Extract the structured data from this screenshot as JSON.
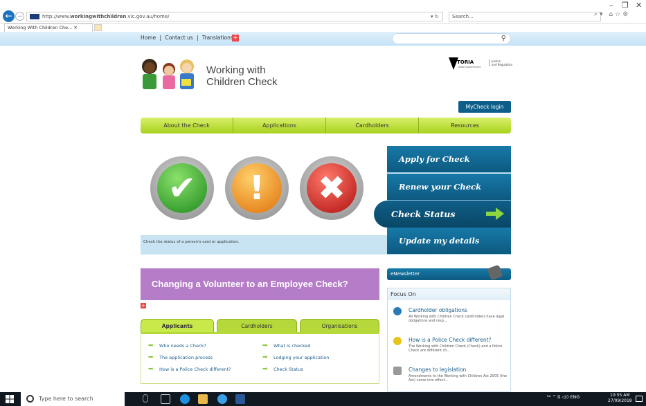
{
  "browser": {
    "url_prefix": "http://www.",
    "url_bold": "workingwithchildren",
    "url_suffix": ".vic.gov.au/home/",
    "refresh_label": "▾ ↻",
    "search_placeholder": "Search...",
    "tab_title": "Working With Children Che... ✕"
  },
  "topnav": {
    "home": "Home",
    "contact": "Contact us",
    "translations": "Translations",
    "sep": "|",
    "plus": "+"
  },
  "logo": {
    "line1": "Working with",
    "line2": "Children Check"
  },
  "victoria": {
    "name": "TORIA",
    "gov": "State Government",
    "dept1": "Justice",
    "dept2": "and Regulation"
  },
  "mycheck_label": "MyCheck login",
  "mainnav": [
    "About the Check",
    "Applications",
    "Cardholders",
    "Resources"
  ],
  "hero": {
    "caption": "Check the status of a person's card or application.",
    "glyph_ok": "✔",
    "glyph_warn": "!",
    "glyph_err": "✖"
  },
  "side_menu": {
    "apply": "Apply for Check",
    "renew": "Renew your Check",
    "status": "Check Status",
    "update": "Update my details"
  },
  "banner": "Changing a Volunteer to an Employee Check?",
  "banner_plus": "+",
  "tabs": [
    "Applicants",
    "Cardholders",
    "Organisations"
  ],
  "links_left": [
    "Who needs a Check?",
    "The application process",
    "How is a Police Check different?"
  ],
  "links_right": [
    "What is checked",
    "Lodging your application",
    "Check Status"
  ],
  "link_arrow": "➡",
  "enewsletter": "eNewsletter",
  "focus": {
    "title": "Focus On",
    "items": [
      {
        "title": "Cardholder obligations",
        "desc": "All Working with Children Check cardholders have legal obligations and resp...",
        "icon": "question-icon",
        "color": "#2a7ab8"
      },
      {
        "title": "How is a Police Check different?",
        "desc": "The Working with Children Check (Check) and a Police Check are different ch...",
        "icon": "lightbulb-icon",
        "color": "#e8c31a"
      },
      {
        "title": "Changes to legislation",
        "desc": "Amendments to the Working with Children Act 2005 (the Act) came into effect...",
        "icon": "document-icon",
        "color": "#999999"
      }
    ]
  },
  "taskbar": {
    "search_placeholder": "Type here to search",
    "tray": "ᴿᴬ  ^  ⌸  ◁))  ENG",
    "time": "10:55 AM",
    "date": "27/09/2018"
  }
}
